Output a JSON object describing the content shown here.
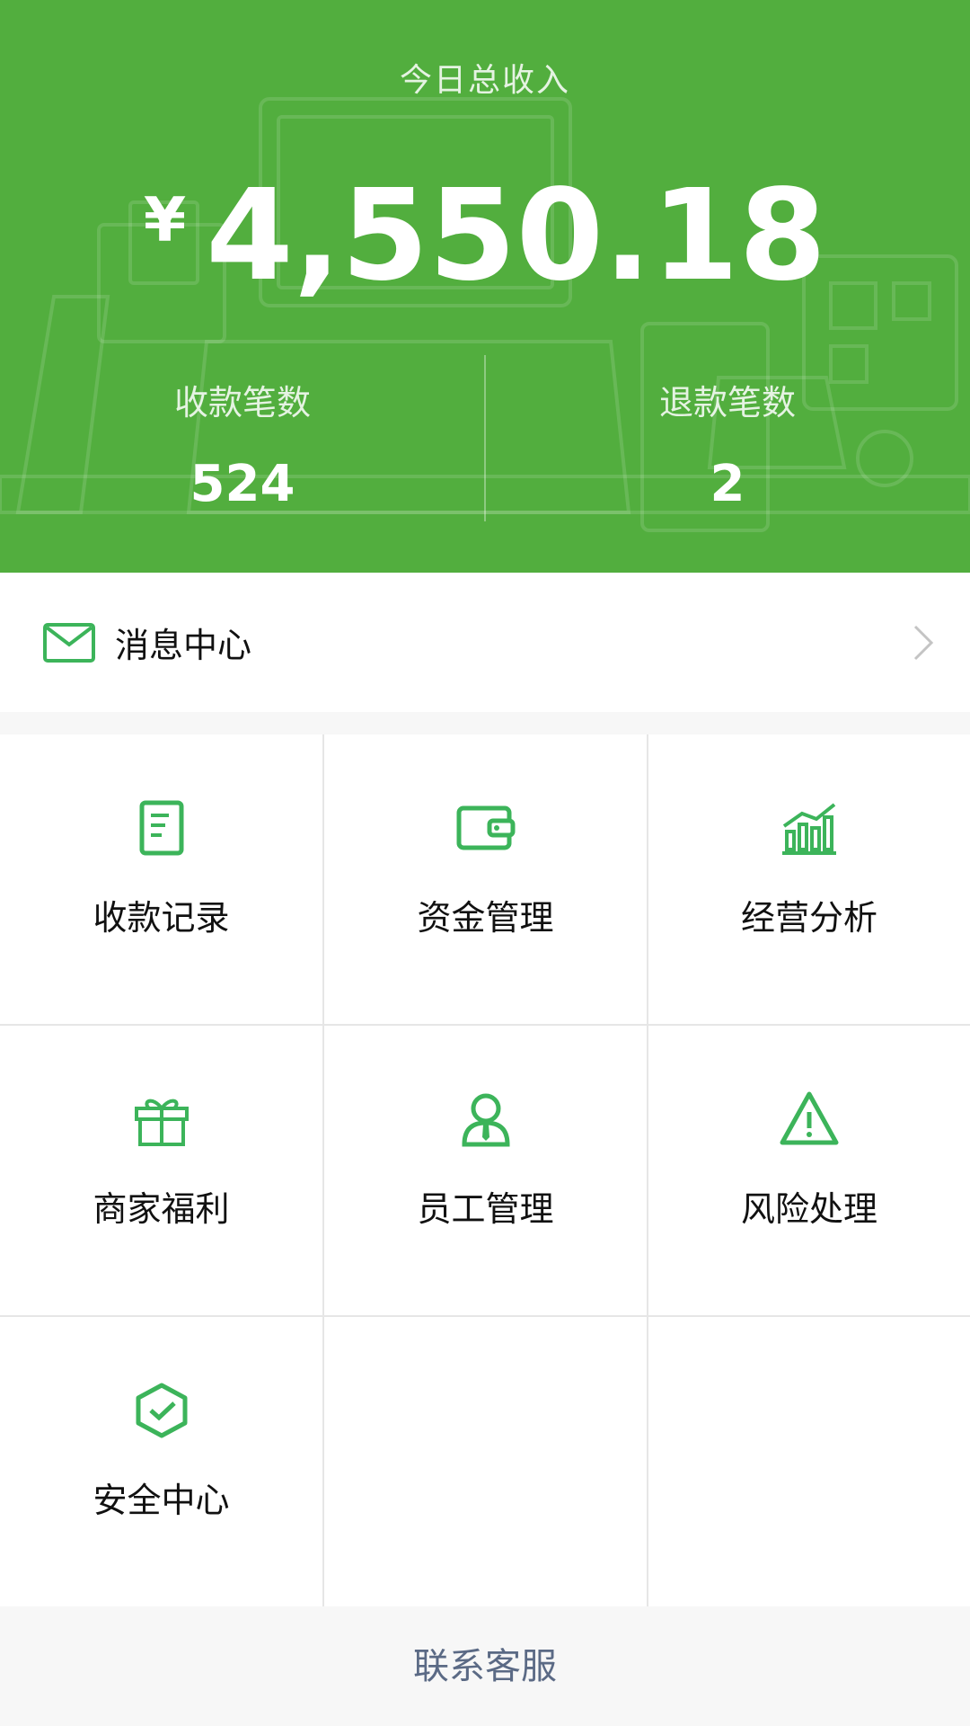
{
  "summary": {
    "title": "今日总收入",
    "currency_symbol": "¥",
    "total_amount": "4,550.18",
    "stats": [
      {
        "label": "收款笔数",
        "value": "524"
      },
      {
        "label": "退款笔数",
        "value": "2"
      }
    ]
  },
  "message_center": {
    "label": "消息中心",
    "icon": "mail-icon"
  },
  "menu": [
    {
      "label": "收款记录",
      "icon": "receipt-icon"
    },
    {
      "label": "资金管理",
      "icon": "wallet-icon"
    },
    {
      "label": "经营分析",
      "icon": "bar-chart-icon"
    },
    {
      "label": "商家福利",
      "icon": "gift-icon"
    },
    {
      "label": "员工管理",
      "icon": "staff-icon"
    },
    {
      "label": "风险处理",
      "icon": "warning-icon"
    },
    {
      "label": "安全中心",
      "icon": "shield-check-icon"
    }
  ],
  "footer": {
    "contact_label": "联系客服"
  },
  "colors": {
    "header_green": "#52ae3e",
    "icon_green": "#3cb45a",
    "footer_link": "#5b6a85"
  }
}
